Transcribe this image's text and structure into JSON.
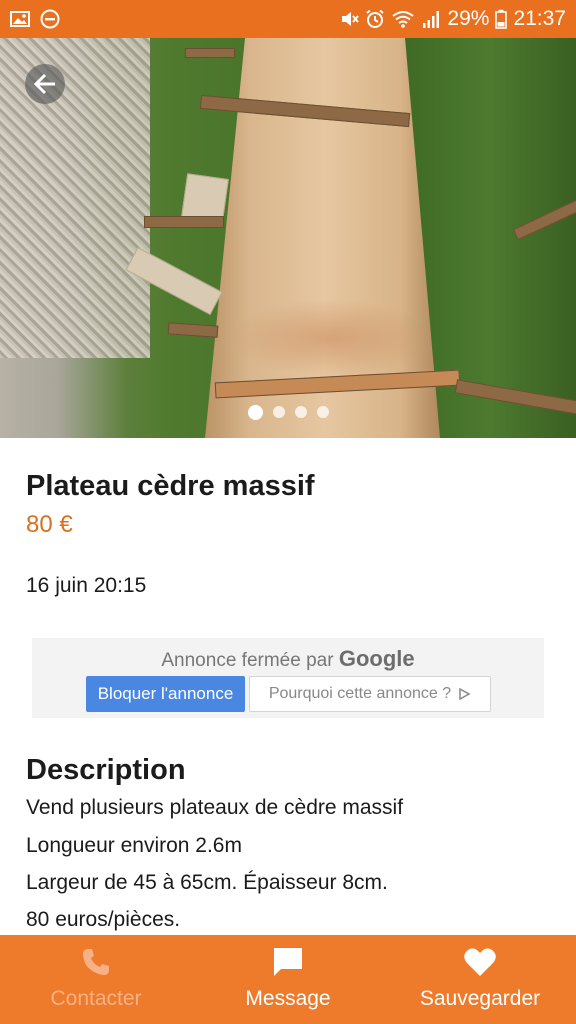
{
  "status_bar": {
    "battery": "29%",
    "time": "21:37",
    "left_icons": [
      "image-icon",
      "do-not-disturb-icon"
    ],
    "right_icons": [
      "mute-icon",
      "alarm-icon",
      "wifi-icon",
      "signal-icon",
      "battery-icon"
    ]
  },
  "gallery": {
    "image_count": 4,
    "active_index": 0,
    "back_icon": "arrow-left-icon"
  },
  "listing": {
    "title": "Plateau cèdre massif",
    "price": "80 €",
    "date": "16 juin 20:15"
  },
  "ad": {
    "closed_text": "Annonce fermée par",
    "provider": "Google",
    "block_label": "Bloquer l'annonce",
    "why_label": "Pourquoi cette annonce ?"
  },
  "description": {
    "heading": "Description",
    "lines": [
      "Vend plusieurs plateaux de cèdre massif",
      "Longueur environ 2.6m",
      "Largeur de 45 à 65cm. Épaisseur 8cm.",
      "80 euros/pièces."
    ]
  },
  "bottom_nav": {
    "contact_label": "Contacter",
    "message_label": "Message",
    "save_label": "Sauvegarder",
    "contact_icon": "phone-icon",
    "message_icon": "chat-bubble-icon",
    "save_icon": "heart-icon"
  },
  "colors": {
    "brand_orange": "#e8701f",
    "bottom_bar": "#ee7a2b",
    "price": "#d9701f",
    "ad_button": "#4a87e3"
  }
}
